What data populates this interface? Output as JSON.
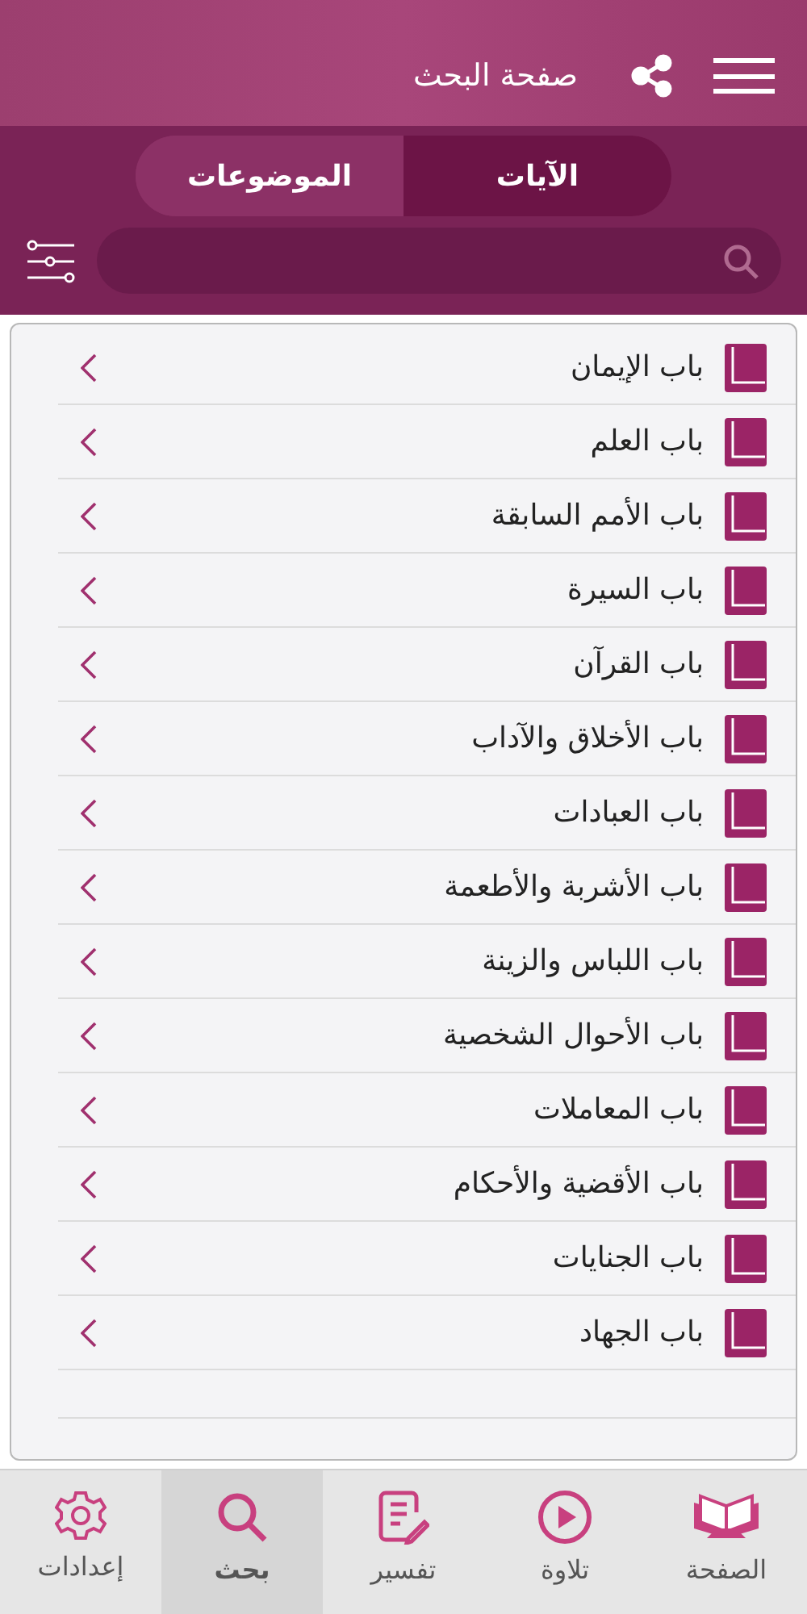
{
  "header": {
    "title": "صفحة البحث"
  },
  "segments": [
    {
      "label": "الآيات",
      "selected": true
    },
    {
      "label": "الموضوعات",
      "selected": false
    }
  ],
  "chapters": [
    {
      "label": "باب الإيمان"
    },
    {
      "label": "باب العلم"
    },
    {
      "label": "باب الأمم السابقة"
    },
    {
      "label": "باب السيرة"
    },
    {
      "label": "باب القرآن"
    },
    {
      "label": "باب الأخلاق والآداب"
    },
    {
      "label": "باب العبادات"
    },
    {
      "label": "باب الأشربة والأطعمة"
    },
    {
      "label": "باب اللباس والزينة"
    },
    {
      "label": "باب الأحوال الشخصية"
    },
    {
      "label": "باب المعاملات"
    },
    {
      "label": "باب الأقضية والأحكام"
    },
    {
      "label": "باب الجنايات"
    },
    {
      "label": "باب الجهاد"
    }
  ],
  "tab_bar": [
    {
      "label": "الصفحة",
      "kind": "book",
      "selected": false
    },
    {
      "label": "تلاوة",
      "kind": "play",
      "selected": false
    },
    {
      "label": "تفسير",
      "kind": "note",
      "selected": false
    },
    {
      "label": "بحث",
      "kind": "search",
      "selected": true
    },
    {
      "label": "إعدادات",
      "kind": "gear",
      "selected": false
    }
  ]
}
